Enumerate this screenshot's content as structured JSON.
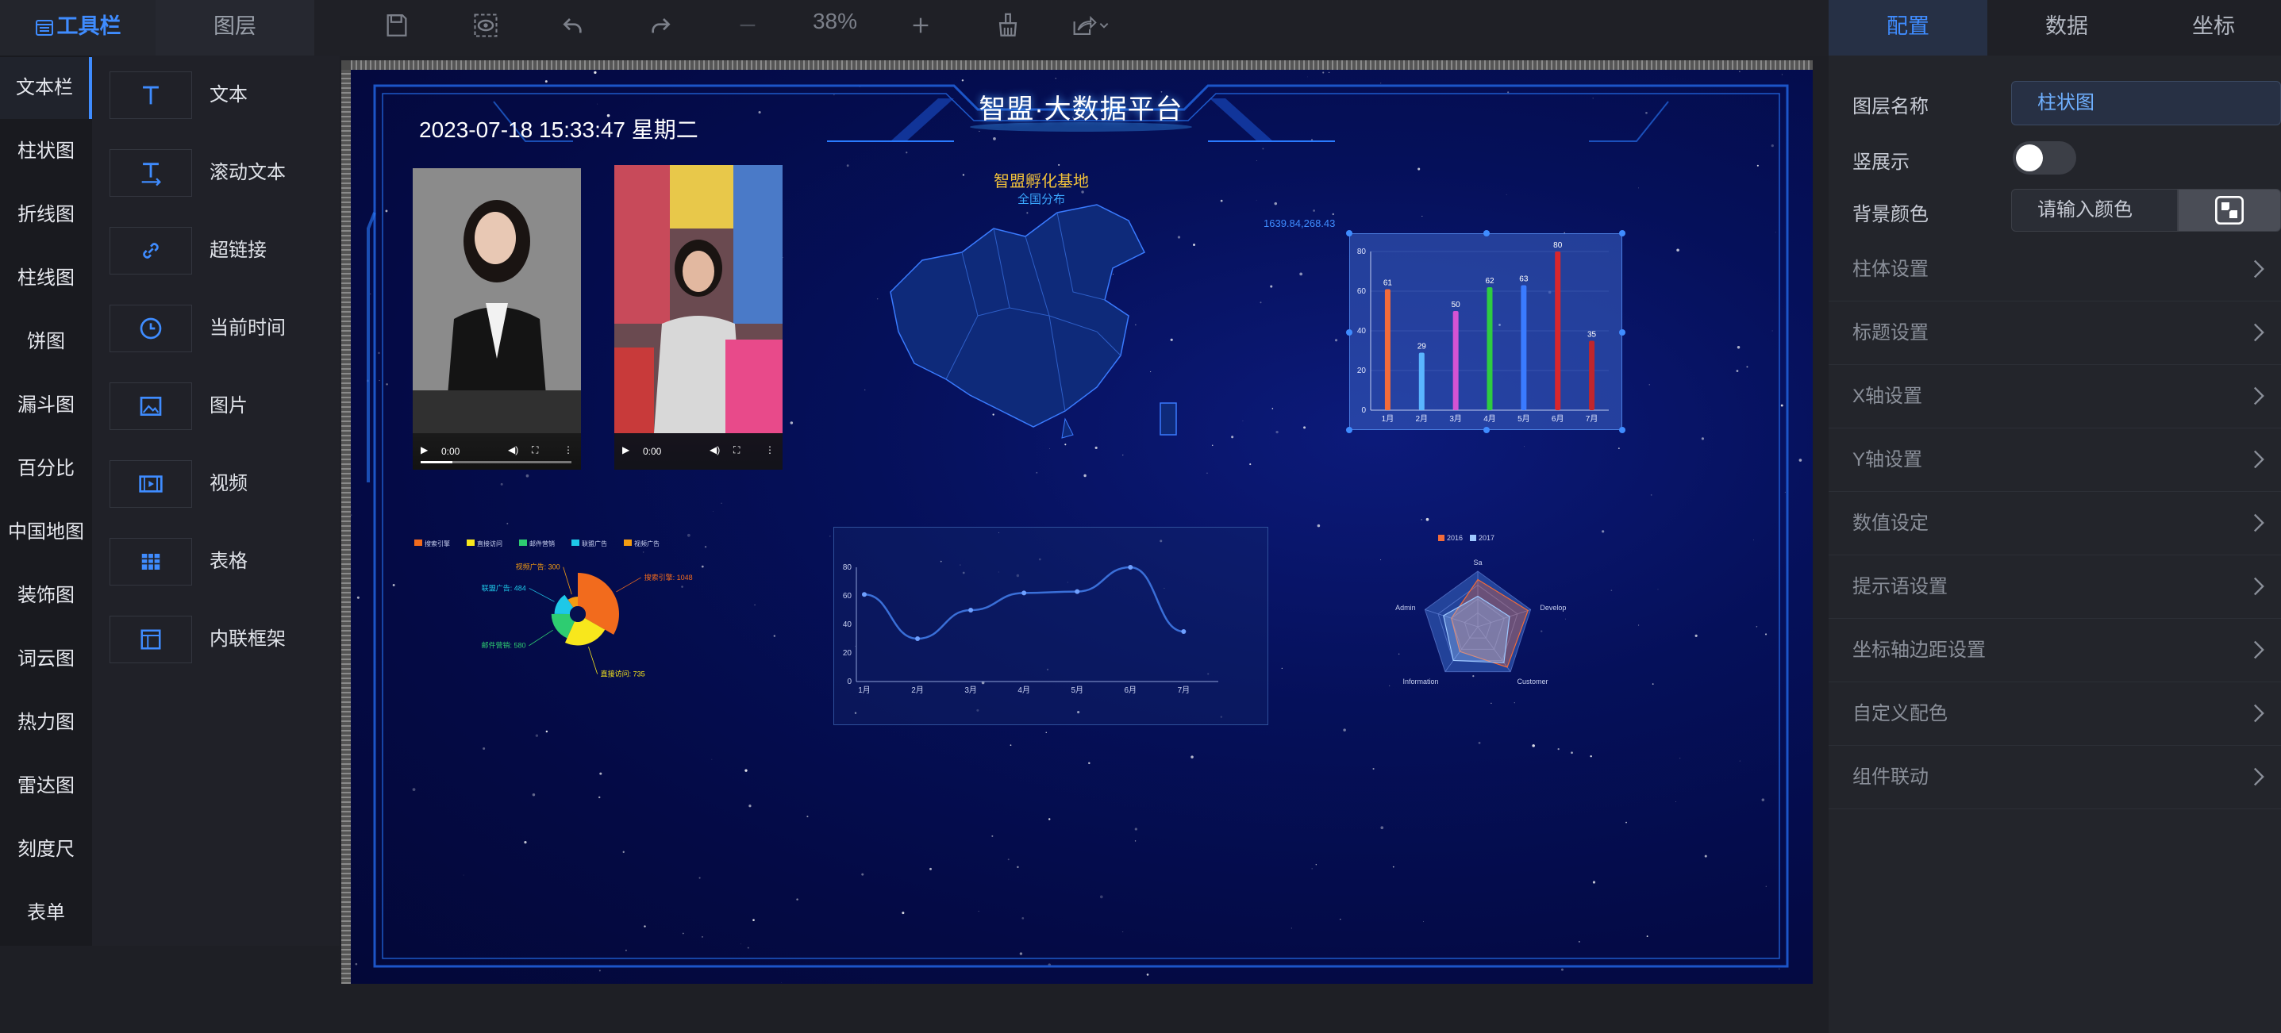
{
  "toolbar": {
    "tab_toolbar": "工具栏",
    "tab_layers": "图层",
    "zoom": "38%"
  },
  "categories": [
    "文本栏",
    "柱状图",
    "折线图",
    "柱线图",
    "饼图",
    "漏斗图",
    "百分比",
    "中国地图",
    "装饰图",
    "词云图",
    "热力图",
    "雷达图",
    "刻度尺",
    "表单"
  ],
  "components": [
    {
      "label": "文本",
      "icon": "text-icon"
    },
    {
      "label": "滚动文本",
      "icon": "scroll-text-icon"
    },
    {
      "label": "超链接",
      "icon": "link-icon"
    },
    {
      "label": "当前时间",
      "icon": "clock-icon"
    },
    {
      "label": "图片",
      "icon": "image-icon"
    },
    {
      "label": "视频",
      "icon": "video-icon"
    },
    {
      "label": "表格",
      "icon": "table-icon"
    },
    {
      "label": "内联框架",
      "icon": "iframe-icon"
    }
  ],
  "canvas": {
    "title": "智盟·大数据平台",
    "datetime": "2023-07-18 15:33:47 星期二",
    "video1_time": "0:00",
    "video2_time": "0:00",
    "map_title": "智盟孵化基地",
    "map_subtitle": "全国分布",
    "map_coord": "1639.84,268.43"
  },
  "chart_data": [
    {
      "type": "bar",
      "categories": [
        "1月",
        "2月",
        "3月",
        "4月",
        "5月",
        "6月",
        "7月"
      ],
      "values": [
        61,
        29,
        50,
        62,
        63,
        80,
        35
      ],
      "ylim": [
        0,
        80
      ],
      "yticks": [
        0,
        20,
        40,
        60,
        80
      ],
      "colors": [
        "#f26b3a",
        "#5ab6ff",
        "#d453d4",
        "#2ecc40",
        "#3a7bff",
        "#d9262c",
        "#c0262c"
      ]
    },
    {
      "type": "pie",
      "legend": [
        "搜索引擎",
        "直接访问",
        "邮件营销",
        "联盟广告",
        "视频广告"
      ],
      "labels": [
        "搜索引擎: 1048",
        "直接访问: 735",
        "邮件营销: 580",
        "联盟广告: 484",
        "视频广告: 300"
      ],
      "values": [
        1048,
        735,
        580,
        484,
        300
      ],
      "colors": [
        "#f26b1d",
        "#f8e71c",
        "#2ecc71",
        "#1ec8e8",
        "#f39c12"
      ]
    },
    {
      "type": "line",
      "categories": [
        "1月",
        "2月",
        "3月",
        "4月",
        "5月",
        "6月",
        "7月"
      ],
      "values": [
        61,
        30,
        50,
        62,
        63,
        80,
        35
      ],
      "ylim": [
        0,
        80
      ],
      "yticks": [
        0,
        20,
        40,
        60,
        80
      ]
    },
    {
      "type": "radar",
      "legend": [
        "2016",
        "2017"
      ],
      "indicators": [
        "Sa",
        "Develop",
        "Customer",
        "Information",
        "Admin"
      ]
    }
  ],
  "panel": {
    "tabs": [
      "配置",
      "数据",
      "坐标"
    ],
    "layer_name_label": "图层名称",
    "layer_name_value": "柱状图",
    "vertical_label": "竖展示",
    "bgcolor_label": "背景颜色",
    "bgcolor_placeholder": "请输入颜色",
    "sections": [
      "柱体设置",
      "标题设置",
      "X轴设置",
      "Y轴设置",
      "数值设定",
      "提示语设置",
      "坐标轴边距设置",
      "自定义配色",
      "组件联动"
    ]
  }
}
